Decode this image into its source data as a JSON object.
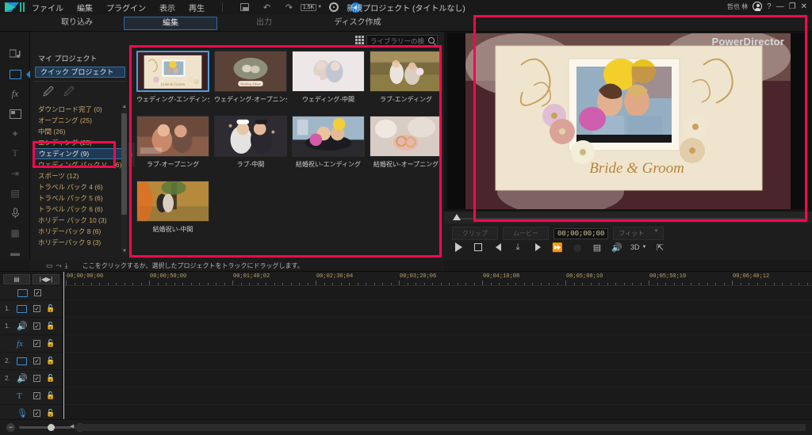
{
  "app": {
    "name": "PowerDirector",
    "project_title": "新規プロジェクト (タイトルなし)",
    "user_name": "哲也 林",
    "brand_color": "#2a7fc9",
    "annotation_color": "#f4084f"
  },
  "menubar": {
    "items": [
      {
        "label": "ファイル",
        "name": "menu-file"
      },
      {
        "label": "編集",
        "name": "menu-edit"
      },
      {
        "label": "プラグイン",
        "name": "menu-plugin"
      },
      {
        "label": "表示",
        "name": "menu-view"
      },
      {
        "label": "再生",
        "name": "menu-play"
      }
    ],
    "icons": [
      {
        "name": "save-icon",
        "glyph": "save"
      },
      {
        "name": "undo-icon",
        "glyph": "↶"
      },
      {
        "name": "redo-icon",
        "glyph": "↷"
      },
      {
        "name": "quality-dropdown-icon",
        "glyph": "1.5K"
      },
      {
        "name": "settings-gear-icon",
        "glyph": "gear"
      },
      {
        "name": "notification-icon",
        "glyph": "!"
      }
    ],
    "window_controls": {
      "help": "?",
      "minimize": "—",
      "maximize": "❐",
      "close": "✕"
    }
  },
  "tabs": [
    {
      "label": "取り込み",
      "name": "tab-capture",
      "active": false,
      "dim": false
    },
    {
      "label": "編集",
      "name": "tab-edit",
      "active": true,
      "dim": false
    },
    {
      "label": "出力",
      "name": "tab-produce",
      "active": false,
      "dim": true
    },
    {
      "label": "ディスク作成",
      "name": "tab-create-disc",
      "active": false,
      "dim": false
    }
  ],
  "rail": {
    "items": [
      {
        "name": "media-room-icon",
        "glyph": "🗂",
        "active": false,
        "dim": false
      },
      {
        "name": "quick-project-room-icon",
        "glyph": "▭",
        "active": true,
        "dim": false
      },
      {
        "name": "effect-room-icon",
        "glyph": "fx",
        "active": false,
        "dim": false
      },
      {
        "name": "pip-object-room-icon",
        "glyph": "▨",
        "active": false,
        "dim": false
      },
      {
        "name": "particle-room-icon",
        "glyph": "✦",
        "active": false,
        "dim": true
      },
      {
        "name": "title-room-icon",
        "glyph": "T",
        "active": false,
        "dim": true
      },
      {
        "name": "transition-room-icon",
        "glyph": "⇥",
        "active": false,
        "dim": true
      },
      {
        "name": "audio-mixing-room-icon",
        "glyph": "▤",
        "active": false,
        "dim": true
      },
      {
        "name": "voice-over-room-icon",
        "glyph": "🎙",
        "active": false,
        "dim": false
      },
      {
        "name": "chapter-room-icon",
        "glyph": "▦",
        "active": false,
        "dim": true
      },
      {
        "name": "subtitle-room-icon",
        "glyph": "▬",
        "active": false,
        "dim": true
      }
    ]
  },
  "library": {
    "search": {
      "placeholder": "ライブラリーの検索",
      "value": ""
    },
    "tree": {
      "heading": "マイ プロジェクト",
      "selected_top": "クイック プロジェクト",
      "items": [
        {
          "label": "ダウンロード完了  (0)",
          "selected": false
        },
        {
          "label": "オープニング  (25)",
          "selected": false
        },
        {
          "label": "中間  (26)",
          "selected": false
        },
        {
          "label": "エンディング  (25)",
          "selected": false
        },
        {
          "label": "ウェディング  (9)",
          "selected": true
        },
        {
          "label": "ウェディング パック V...  (6)",
          "selected": false
        },
        {
          "label": "スポーツ  (12)",
          "selected": false
        },
        {
          "label": "トラベル パック 4  (6)",
          "selected": false
        },
        {
          "label": "トラベル パック 5  (6)",
          "selected": false
        },
        {
          "label": "トラベル パック 6  (6)",
          "selected": false
        },
        {
          "label": "ホリデー パック 10  (3)",
          "selected": false
        },
        {
          "label": "ホリデーパック 8  (6)",
          "selected": false
        },
        {
          "label": "ホリデーパック 9  (3)",
          "selected": false
        }
      ]
    },
    "thumbnails": [
      {
        "label": "ウェディング-エンディング",
        "selected": true,
        "art": "wed-ending"
      },
      {
        "label": "ウェディング-オープニング",
        "selected": false,
        "art": "wed-opening"
      },
      {
        "label": "ウェディング-中間",
        "selected": false,
        "art": "wed-mid"
      },
      {
        "label": "ラブ-エンディング",
        "selected": false,
        "art": "love-ending"
      },
      {
        "label": "ラブ-オープニング",
        "selected": false,
        "art": "love-opening"
      },
      {
        "label": "ラブ-中間",
        "selected": false,
        "art": "love-mid"
      },
      {
        "label": "結婚祝い-エンディング",
        "selected": false,
        "art": "cel-ending"
      },
      {
        "label": "結婚祝い-オープニング",
        "selected": false,
        "art": "cel-opening"
      },
      {
        "label": "結婚祝い-中間",
        "selected": false,
        "art": "cel-mid"
      }
    ]
  },
  "hint_bar": {
    "text": "ここをクリックするか、選択したプロジェクトをトラックにドラッグします。"
  },
  "preview": {
    "overlay_title": "Bride & Groom",
    "watermark": "PowerDirector",
    "controls": {
      "clip_label": "クリップ",
      "movie_label": "ムービー",
      "timecode": "00;00;00;00",
      "fit_label": "フィット",
      "buttons": [
        {
          "name": "play-button",
          "glyph": "▶"
        },
        {
          "name": "stop-button",
          "glyph": "■"
        },
        {
          "name": "previous-frame-button",
          "glyph": "◀"
        },
        {
          "name": "step-button",
          "glyph": "⤓"
        },
        {
          "name": "next-frame-button",
          "glyph": "▶"
        },
        {
          "name": "fast-forward-button",
          "glyph": "▶▶"
        },
        {
          "name": "snapshot-button",
          "glyph": "◎"
        },
        {
          "name": "display-options-button",
          "glyph": "▤"
        },
        {
          "name": "volume-button",
          "glyph": "🔊"
        },
        {
          "name": "3d-mode-button",
          "glyph": "3D"
        },
        {
          "name": "detach-preview-button",
          "glyph": "⇱"
        }
      ],
      "mode_3d": "3D"
    }
  },
  "timeline": {
    "tool_buttons": [
      {
        "name": "track-manager-button",
        "glyph": "▤"
      },
      {
        "name": "fit-timeline-button",
        "glyph": "|◀▶|"
      }
    ],
    "ruler_labels": [
      "00;00;00;00",
      "00;00;50;00",
      "00;01;40;02",
      "00;02;30;04",
      "00;03;20;06",
      "00;04;10;08",
      "00;05;00;10",
      "00;05;50;10",
      "00;06;40;12"
    ],
    "tracks": [
      {
        "num": "",
        "type": "master-video",
        "icon": "video-icon",
        "checked": true,
        "lock": false
      },
      {
        "num": "1.",
        "type": "video",
        "icon": "video-icon",
        "checked": true,
        "lock": true
      },
      {
        "num": "1.",
        "type": "audio",
        "icon": "audio-icon",
        "checked": true,
        "lock": true
      },
      {
        "num": "",
        "type": "effect",
        "icon": "fx-icon",
        "checked": true,
        "lock": true
      },
      {
        "num": "2.",
        "type": "video",
        "icon": "video-icon",
        "checked": true,
        "lock": true
      },
      {
        "num": "2.",
        "type": "audio",
        "icon": "audio-icon",
        "checked": true,
        "lock": true
      },
      {
        "num": "",
        "type": "title",
        "icon": "title-icon",
        "checked": true,
        "lock": true
      },
      {
        "num": "",
        "type": "voice",
        "icon": "mic-icon",
        "checked": true,
        "lock": true
      },
      {
        "num": "",
        "type": "music",
        "icon": "music-icon",
        "checked": true,
        "lock": true
      }
    ],
    "zoom": {
      "minus": "−",
      "plus": "+"
    }
  }
}
